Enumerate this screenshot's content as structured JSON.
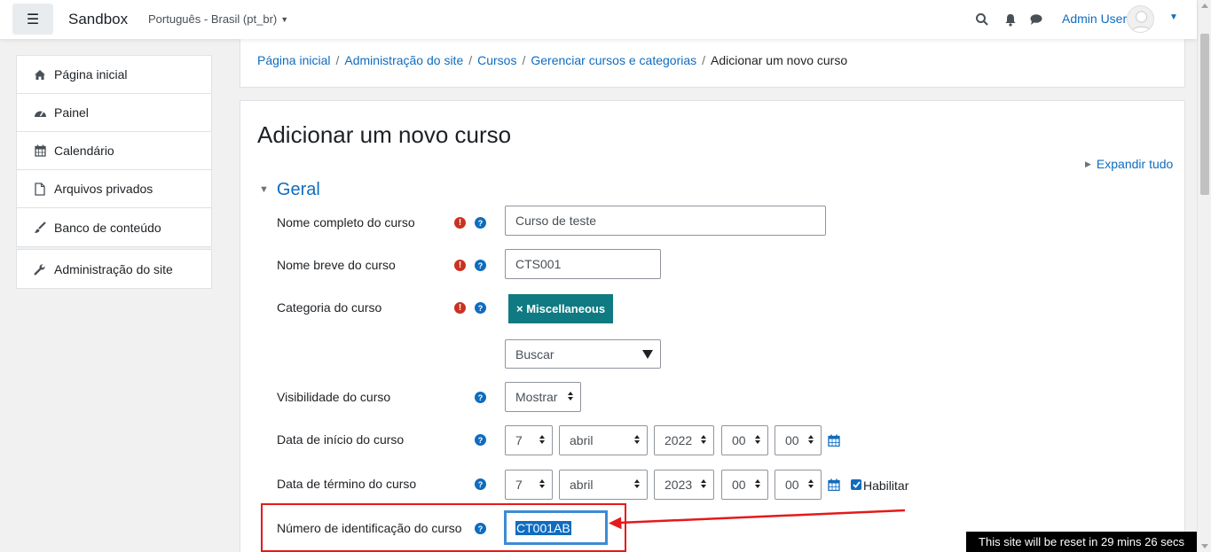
{
  "navbar": {
    "site_name": "Sandbox",
    "language": "Português - Brasil (pt_br)",
    "user_name": "Admin User"
  },
  "drawer": {
    "items": [
      {
        "label": "Página inicial",
        "icon": "home-icon"
      },
      {
        "label": "Painel",
        "icon": "dashboard-icon"
      },
      {
        "label": "Calendário",
        "icon": "calendar-icon"
      },
      {
        "label": "Arquivos privados",
        "icon": "file-icon"
      },
      {
        "label": "Banco de conteúdo",
        "icon": "brush-icon"
      }
    ],
    "admin": {
      "label": "Administração do site",
      "icon": "wrench-icon"
    }
  },
  "breadcrumb": {
    "items": [
      "Página inicial",
      "Administração do site",
      "Cursos",
      "Gerenciar cursos e categorias"
    ],
    "current": "Adicionar um novo curso"
  },
  "page": {
    "title": "Adicionar um novo curso",
    "expand_all": "Expandir tudo",
    "section": "Geral"
  },
  "form": {
    "fullname": {
      "label": "Nome completo do curso",
      "value": "Curso de teste"
    },
    "shortname": {
      "label": "Nome breve do curso",
      "value": "CTS001"
    },
    "category": {
      "label": "Categoria do curso",
      "badge": "× Miscellaneous",
      "search_placeholder": "Buscar"
    },
    "visibility": {
      "label": "Visibilidade do curso",
      "value": "Mostrar"
    },
    "startdate": {
      "label": "Data de início do curso",
      "day": "7",
      "month": "abril",
      "year": "2022",
      "hour": "00",
      "minute": "00"
    },
    "enddate": {
      "label": "Data de término do curso",
      "day": "7",
      "month": "abril",
      "year": "2023",
      "hour": "00",
      "minute": "00",
      "enable_label": "Habilitar",
      "enabled": true
    },
    "idnumber": {
      "label": "Número de identificação do curso",
      "value": "CT001AB"
    }
  },
  "reset_notice": "This site will be reset in 29 mins 26 secs",
  "colors": {
    "link": "#0f6cbf",
    "badge": "#0f7a82",
    "required": "#ca3120",
    "annotation": "#e41a1a"
  }
}
